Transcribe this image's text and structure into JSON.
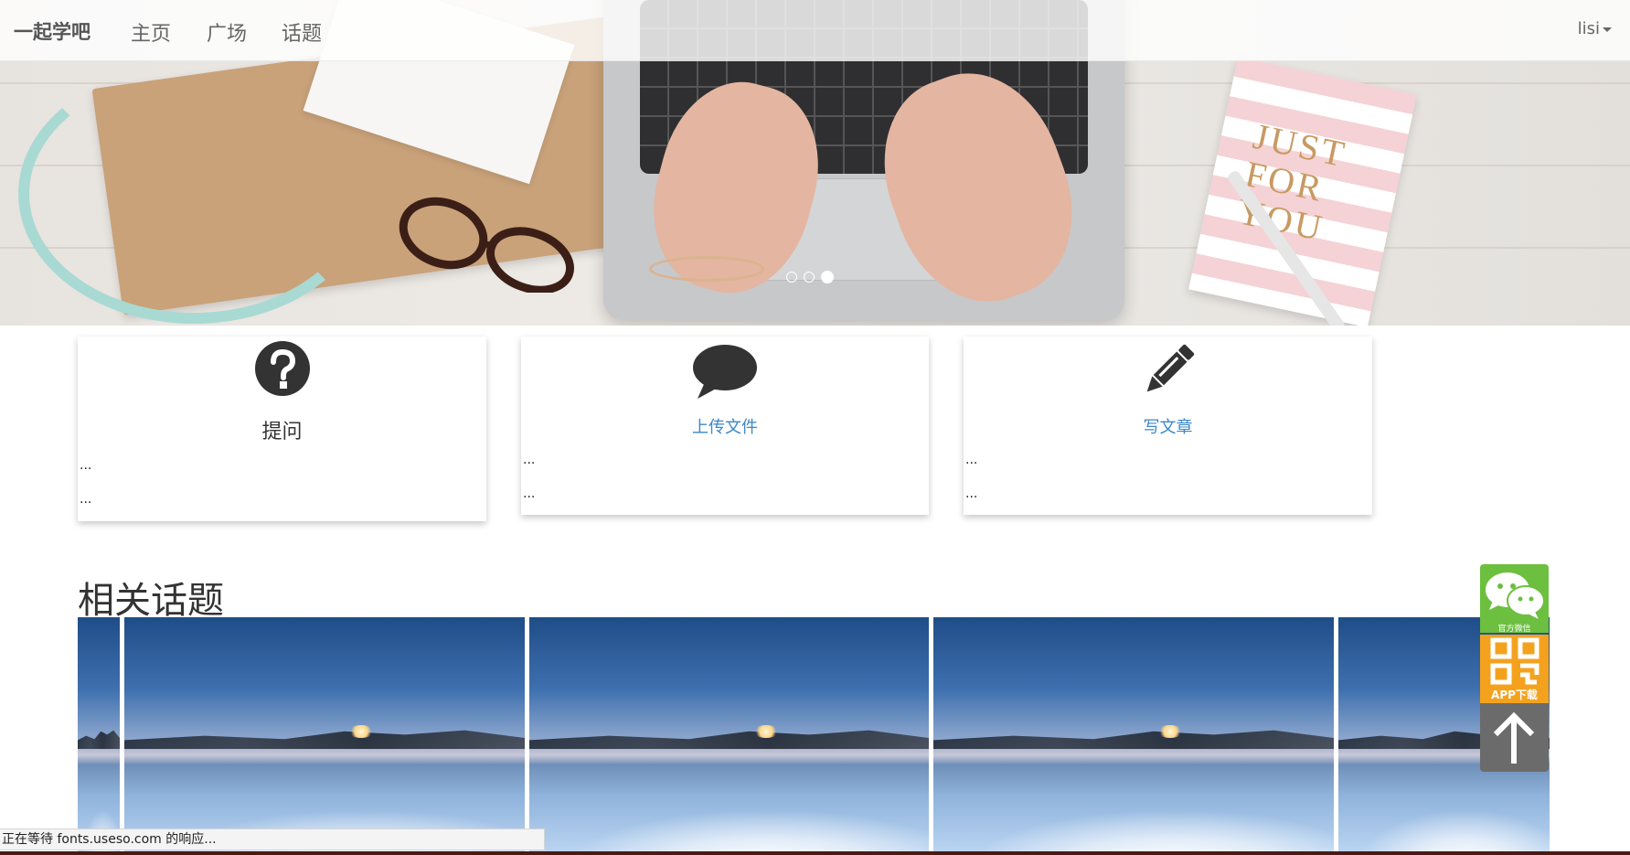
{
  "navbar": {
    "brand": "一起学吧",
    "items": [
      {
        "label": "主页"
      },
      {
        "label": "广场"
      },
      {
        "label": "话题"
      }
    ],
    "user": "lisi"
  },
  "carousel": {
    "notebook_text": "JUST FOR YOU",
    "slide_count": 3,
    "active_index": 2
  },
  "cards": [
    {
      "icon": "question-circle-icon",
      "label": "提问",
      "lines": [
        "...",
        "..."
      ]
    },
    {
      "icon": "comment-icon",
      "label": "上传文件",
      "lines": [
        "...",
        "..."
      ]
    },
    {
      "icon": "pencil-icon",
      "label": "写文章",
      "lines": [
        "...",
        "..."
      ]
    }
  ],
  "section": {
    "title": "相关话题"
  },
  "side_tools": {
    "wechat_caption": "官方微信",
    "app_caption": "APP下载"
  },
  "status": {
    "text": "正在等待 fonts.useso.com 的响应..."
  },
  "colors": {
    "link": "#3a87c8",
    "wechat": "#6cbf3f",
    "app": "#f4a21e",
    "totop": "#6b6b6b"
  }
}
